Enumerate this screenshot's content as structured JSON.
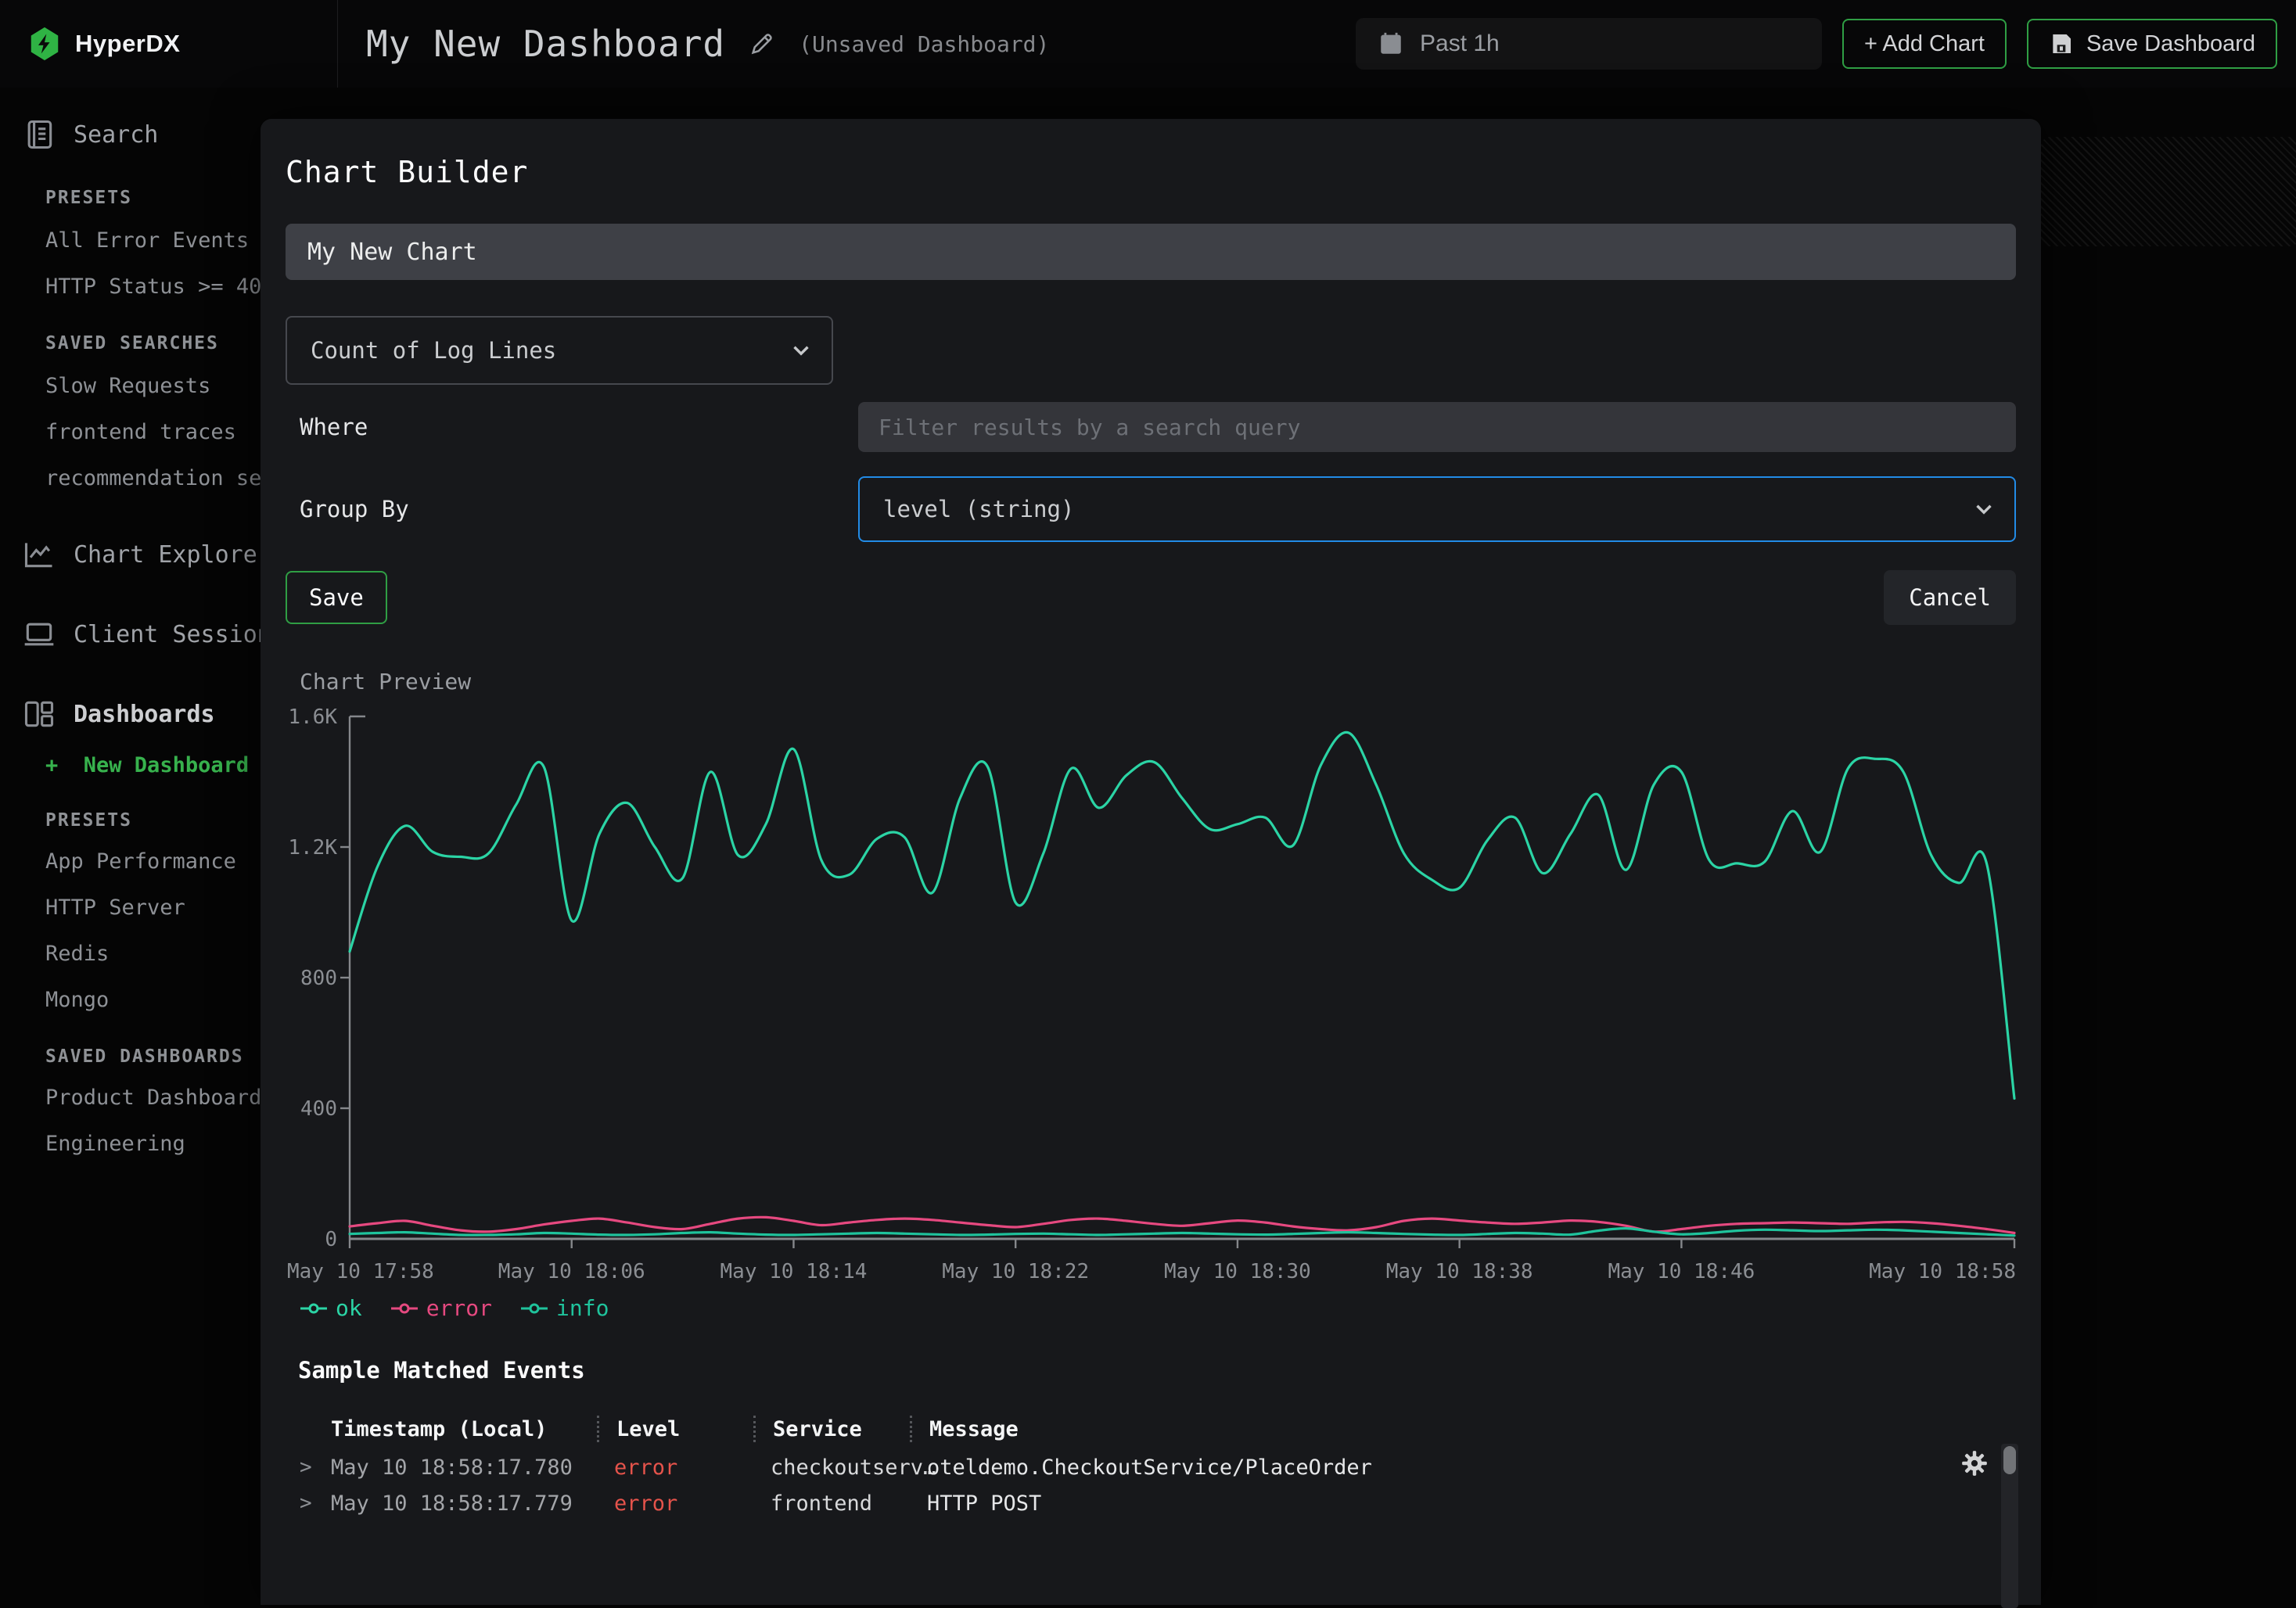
{
  "colors": {
    "logo_green": "#2fb344",
    "accent_green": "#2f9e44",
    "focus_blue": "#228be6",
    "new_dashboard_green": "#37b24d",
    "error_text": "#e5534b"
  },
  "topbar": {
    "logo_text": "HyperDX",
    "title": "My New Dashboard",
    "subtitle": "(Unsaved Dashboard)",
    "time_range_label": "Past 1h",
    "add_chart_label": "+ Add Chart",
    "save_dashboard_label": "Save Dashboard"
  },
  "sidebar": {
    "search_label": "Search",
    "presets_heading": "PRESETS",
    "preset_items": [
      "All Error Events",
      "HTTP Status >= 40"
    ],
    "saved_searches_heading": "SAVED SEARCHES",
    "saved_search_items": [
      "Slow Requests",
      "frontend traces",
      "recommendation se"
    ],
    "chart_explorer_label": "Chart Explorer",
    "client_sessions_label": "Client Sessions",
    "dashboards_label": "Dashboards",
    "new_dashboard_plus": "+",
    "new_dashboard_label": "New Dashboard",
    "dash_presets_heading": "PRESETS",
    "dash_preset_items": [
      "App Performance",
      "HTTP Server",
      "Redis",
      "Mongo"
    ],
    "saved_dashboards_heading": "SAVED DASHBOARDS",
    "saved_dashboard_items": [
      "Product Dashboard",
      "Engineering"
    ]
  },
  "modal": {
    "title": "Chart Builder",
    "name_value": "My New Chart",
    "aggregation_value": "Count of Log Lines",
    "where_label": "Where",
    "where_placeholder": "Filter results by a search query",
    "group_by_label": "Group By",
    "group_by_value": "level (string)",
    "save_label": "Save",
    "cancel_label": "Cancel",
    "preview_label": "Chart Preview",
    "events_heading": "Sample Matched Events"
  },
  "chart_data": {
    "type": "line",
    "x_axis": "time",
    "x_max_minutes": 60,
    "x_tick_minutes": [
      0,
      8,
      16,
      24,
      32,
      40,
      48,
      60
    ],
    "x_tick_labels": [
      "May 10 17:58",
      "May 10 18:06",
      "May 10 18:14",
      "May 10 18:22",
      "May 10 18:30",
      "May 10 18:38",
      "May 10 18:46",
      "May 10 18:58"
    ],
    "ylim": [
      0,
      1600
    ],
    "y_ticks": [
      0,
      400,
      800,
      1200,
      1600
    ],
    "y_tick_labels": [
      "0",
      "400",
      "800",
      "1.2K",
      "1.6K"
    ],
    "grid": false,
    "legend_position": "bottom-left",
    "series": [
      {
        "name": "ok",
        "color": "#2bd4a5",
        "values": [
          880,
          1140,
          1265,
          1185,
          1170,
          1180,
          1330,
          1445,
          975,
          1240,
          1335,
          1200,
          1105,
          1430,
          1175,
          1270,
          1500,
          1160,
          1115,
          1225,
          1230,
          1060,
          1350,
          1445,
          1030,
          1180,
          1440,
          1320,
          1420,
          1460,
          1350,
          1255,
          1270,
          1290,
          1205,
          1450,
          1550,
          1390,
          1180,
          1100,
          1075,
          1220,
          1290,
          1120,
          1240,
          1360,
          1130,
          1390,
          1430,
          1160,
          1150,
          1155,
          1310,
          1185,
          1440,
          1470,
          1430,
          1175,
          1090,
          1150,
          430
        ]
      },
      {
        "name": "error",
        "color": "#e64980",
        "values": [
          38,
          48,
          55,
          40,
          26,
          22,
          30,
          44,
          55,
          62,
          50,
          36,
          30,
          46,
          62,
          66,
          55,
          42,
          50,
          58,
          62,
          58,
          50,
          42,
          36,
          46,
          58,
          62,
          55,
          46,
          40,
          48,
          56,
          50,
          38,
          30,
          26,
          36,
          55,
          62,
          56,
          50,
          46,
          50,
          56,
          52,
          40,
          22,
          30,
          40,
          46,
          48,
          50,
          48,
          46,
          50,
          52,
          48,
          40,
          30,
          18
        ]
      },
      {
        "name": "info",
        "color": "#1fc39c",
        "values": [
          15,
          18,
          20,
          16,
          12,
          12,
          14,
          18,
          16,
          13,
          12,
          14,
          18,
          20,
          16,
          13,
          12,
          14,
          16,
          18,
          16,
          14,
          12,
          13,
          15,
          16,
          14,
          12,
          14,
          16,
          18,
          16,
          14,
          13,
          15,
          18,
          20,
          18,
          15,
          13,
          12,
          15,
          18,
          16,
          13,
          25,
          32,
          22,
          14,
          18,
          25,
          28,
          26,
          24,
          26,
          28,
          26,
          22,
          18,
          14,
          10
        ]
      }
    ]
  },
  "events": {
    "chevron_glyph": ">",
    "columns": [
      "Timestamp (Local)",
      "Level",
      "Service",
      "Message"
    ],
    "rows": [
      {
        "timestamp": "May 10 18:58:17.780",
        "level": "error",
        "service": "checkoutserv…",
        "message": "oteldemo.CheckoutService/PlaceOrder"
      },
      {
        "timestamp": "May 10 18:58:17.779",
        "level": "error",
        "service": "frontend",
        "message": "HTTP POST"
      }
    ]
  }
}
